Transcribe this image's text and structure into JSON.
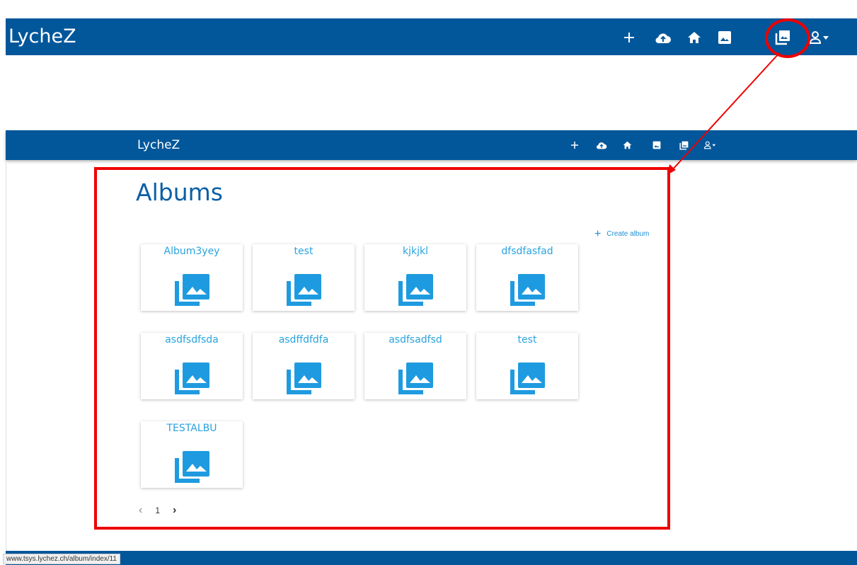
{
  "app": {
    "brand": "LycheZ"
  },
  "inner": {
    "brand": "LycheZ"
  },
  "nav": [
    {
      "key": "add",
      "icon": "plus-icon"
    },
    {
      "key": "upload",
      "icon": "cloud-upload-icon"
    },
    {
      "key": "home",
      "icon": "home-icon"
    },
    {
      "key": "photos",
      "icon": "image-icon"
    },
    {
      "key": "albums",
      "icon": "photo-library-icon"
    },
    {
      "key": "account",
      "icon": "account-dropdown-icon"
    }
  ],
  "page": {
    "title": "Albums",
    "create_label": "Create album"
  },
  "albums": [
    {
      "name": "Album3yey"
    },
    {
      "name": "test"
    },
    {
      "name": "kjkjkl"
    },
    {
      "name": "dfsdfasfad"
    },
    {
      "name": "asdfsdfsda"
    },
    {
      "name": "asdffdfdfa"
    },
    {
      "name": "asdfsadfsd"
    },
    {
      "name": "test"
    },
    {
      "name": "TESTALBU"
    }
  ],
  "pagination": {
    "current": "1"
  },
  "status": {
    "url": "www.tsys.lychez.ch/album/index/11"
  },
  "colors": {
    "bar": "#02579b",
    "accent": "#29a3df",
    "annotation": "#ee0000"
  }
}
